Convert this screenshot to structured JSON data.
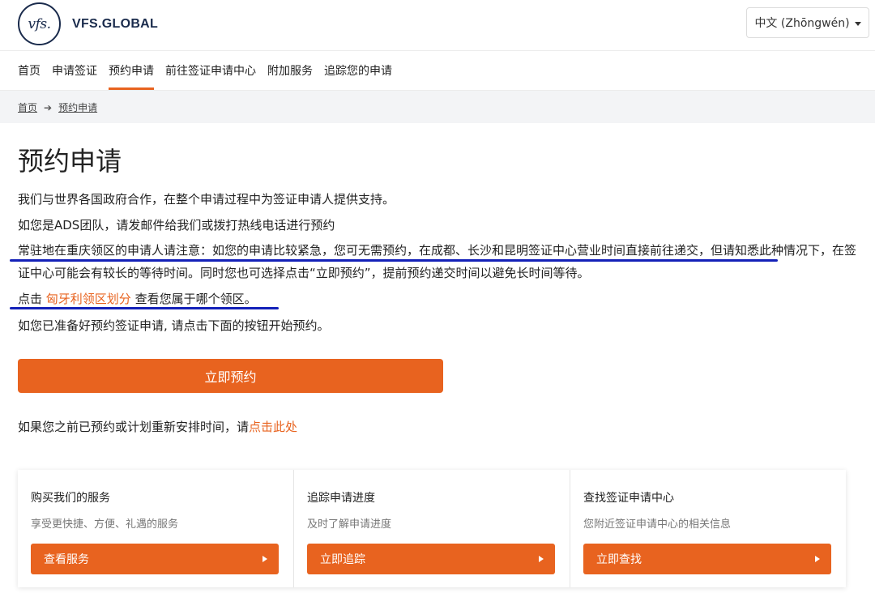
{
  "header": {
    "logo_mark": "vfs.",
    "logo_text": "VFS.GLOBAL",
    "language": "中文 (Zhōngwén)"
  },
  "nav": {
    "items": [
      "首页",
      "申请签证",
      "预约申请",
      "前往签证申请中心",
      "附加服务",
      "追踪您的申请"
    ],
    "active_index": 2
  },
  "breadcrumb": {
    "home": "首页",
    "current": "预约申请"
  },
  "page": {
    "title": "预约申请",
    "p1": "我们与世界各国政府合作，在整个申请过程中为签证申请人提供支持。",
    "p2": "如您是ADS团队，请发邮件给我们或拨打热线电话进行预约",
    "p3_highlight": "常驻地在重庆领区的申请人请注意：如您的申请比较紧急，您可无需预约，在成都、长沙和昆明签证中心营业时间直接前往递交，",
    "p3_rest": "但请知悉此种情况下，在签证中心可能会有较长的等待时间。同时您也可选择点击“立即预约”，提前预约递交时间以避免长时间等待。",
    "p4_prefix": "点击 ",
    "p4_link": "匈牙利领区划分",
    "p4_suffix": " 查看您属于哪个领区。",
    "p5": "如您已准备好预约签证申请, 请点击下面的按钮开始预约。",
    "book_button": "立即预约",
    "p6_prefix": "如果您之前已预约或计划重新安排时间，请",
    "p6_link": "点击此处"
  },
  "cards": [
    {
      "title": "购买我们的服务",
      "subtitle": "享受更快捷、方便、礼遇的服务",
      "button": "查看服务"
    },
    {
      "title": "追踪申请进度",
      "subtitle": "及时了解申请进度",
      "button": "立即追踪"
    },
    {
      "title": "查找签证申请中心",
      "subtitle": "您附近签证申请中心的相关信息",
      "button": "立即查找"
    }
  ],
  "colors": {
    "accent": "#e8631f",
    "annotation": "#1320b8",
    "brand": "#1a2b4c"
  }
}
